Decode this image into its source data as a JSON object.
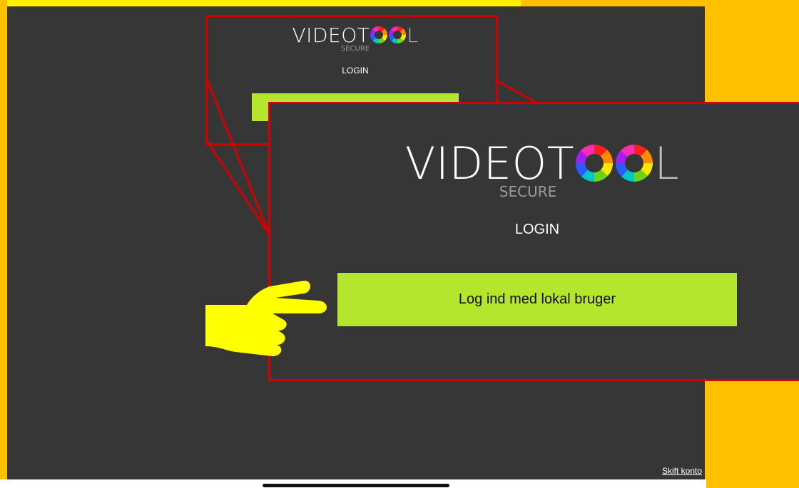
{
  "app": {
    "logo_text": "VIDEO",
    "logo_text_tail": "T",
    "logo_text_end": "L",
    "logo_sub": "SECURE"
  },
  "login": {
    "title": "LOGIN",
    "button_label": "Log ind med lokal bruger"
  },
  "footer": {
    "switch_account": "Skift konto"
  },
  "annotation": {
    "highlight_color": "#d40000",
    "pointer_color": "#ffff00"
  },
  "colors": {
    "background": "#363636",
    "button": "#b5e62e",
    "outer_frame": "#ffc000"
  }
}
